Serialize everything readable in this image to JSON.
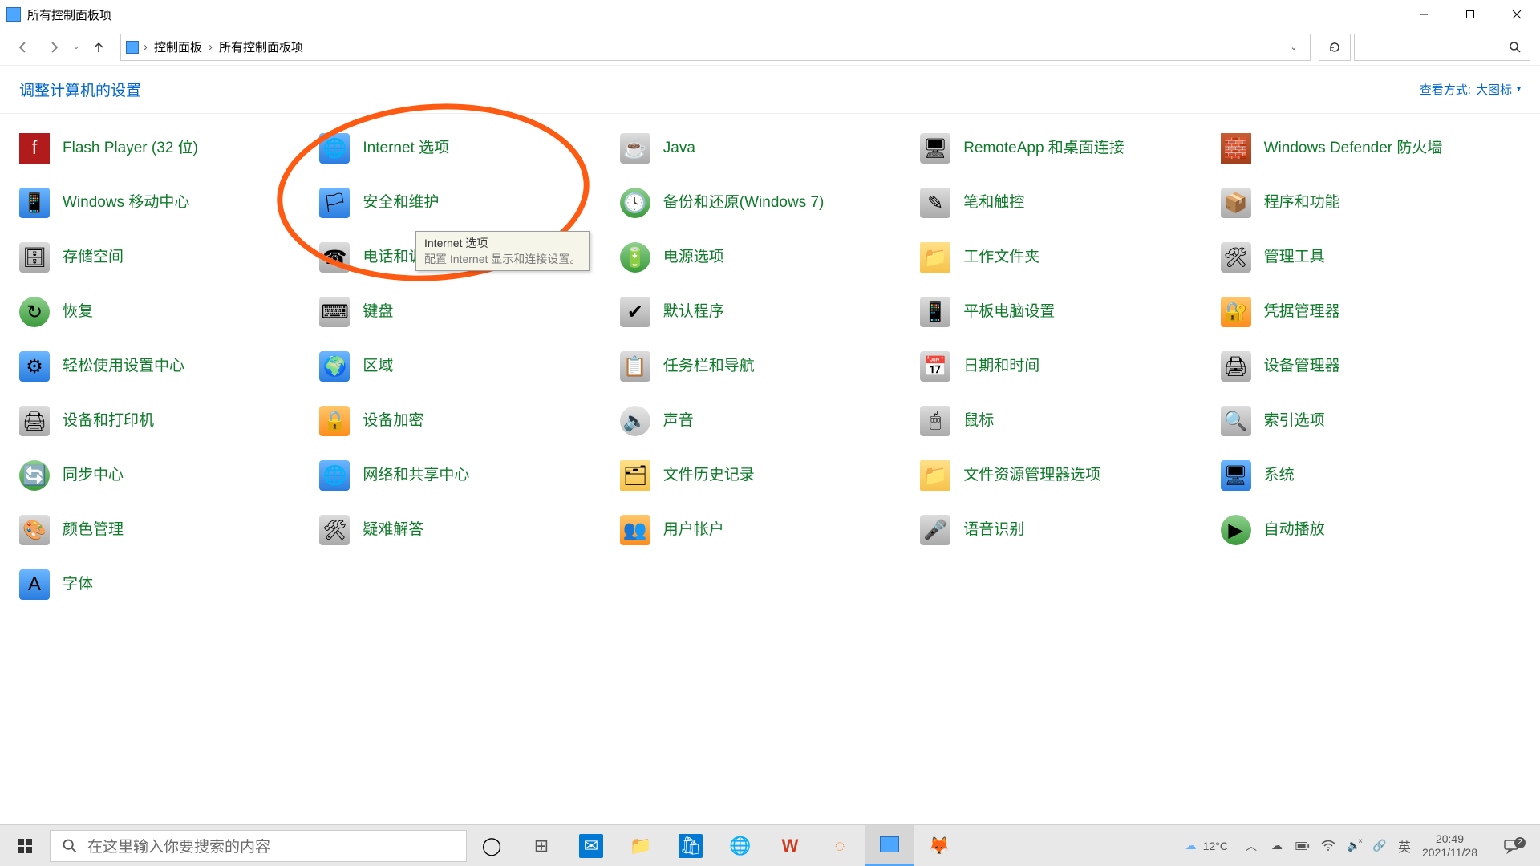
{
  "window": {
    "title": "所有控制面板项"
  },
  "nav": {
    "breadcrumb": [
      "控制面板",
      "所有控制面板项"
    ]
  },
  "header": {
    "title": "调整计算机的设置",
    "view_label": "查看方式:",
    "view_value": "大图标"
  },
  "tooltip": {
    "title": "Internet 选项",
    "desc": "配置 Internet 显示和连接设置。"
  },
  "items": [
    {
      "label": "Flash Player (32 位)",
      "name": "flash-player",
      "ic": "ic1",
      "ch": "f"
    },
    {
      "label": "Internet 选项",
      "name": "internet-options",
      "ic": "ic-blue",
      "ch": "🌐"
    },
    {
      "label": "Java",
      "name": "java",
      "ic": "ic-grey",
      "ch": "☕"
    },
    {
      "label": "RemoteApp 和桌面连接",
      "name": "remoteapp",
      "ic": "ic-grey",
      "ch": "🖥"
    },
    {
      "label": "Windows Defender 防火墙",
      "name": "windows-defender-firewall",
      "ic": "ic-firewall",
      "ch": "🧱",
      "twoline": true
    },
    {
      "label": "Windows 移动中心",
      "name": "mobility-center",
      "ic": "ic-blue",
      "ch": "📱"
    },
    {
      "label": "安全和维护",
      "name": "security-maintenance",
      "ic": "ic-blue",
      "ch": "🏳"
    },
    {
      "label": "备份和还原(Windows 7)",
      "name": "backup-restore",
      "ic": "ic-green",
      "ch": "🕓"
    },
    {
      "label": "笔和触控",
      "name": "pen-touch",
      "ic": "ic-grey",
      "ch": "✎"
    },
    {
      "label": "程序和功能",
      "name": "programs-features",
      "ic": "ic-grey",
      "ch": "📦"
    },
    {
      "label": "存储空间",
      "name": "storage-spaces",
      "ic": "ic-grey",
      "ch": "🗄"
    },
    {
      "label": "电话和调制解调器",
      "name": "phone-modem",
      "ic": "ic-grey",
      "ch": "☎"
    },
    {
      "label": "电源选项",
      "name": "power-options",
      "ic": "ic-green",
      "ch": "🔋"
    },
    {
      "label": "工作文件夹",
      "name": "work-folders",
      "ic": "ic-folder",
      "ch": "📁"
    },
    {
      "label": "管理工具",
      "name": "admin-tools",
      "ic": "ic-grey",
      "ch": "🛠"
    },
    {
      "label": "恢复",
      "name": "recovery",
      "ic": "ic-green",
      "ch": "↻"
    },
    {
      "label": "键盘",
      "name": "keyboard",
      "ic": "ic-grey",
      "ch": "⌨"
    },
    {
      "label": "默认程序",
      "name": "default-programs",
      "ic": "ic-grey",
      "ch": "✔"
    },
    {
      "label": "平板电脑设置",
      "name": "tablet-pc",
      "ic": "ic-grey",
      "ch": "📱"
    },
    {
      "label": "凭据管理器",
      "name": "credential-manager",
      "ic": "ic-orange",
      "ch": "🔐"
    },
    {
      "label": "轻松使用设置中心",
      "name": "ease-of-access",
      "ic": "ic-blue",
      "ch": "⚙"
    },
    {
      "label": "区域",
      "name": "region",
      "ic": "ic-blue",
      "ch": "🌍"
    },
    {
      "label": "任务栏和导航",
      "name": "taskbar-navigation",
      "ic": "ic-grey",
      "ch": "📋"
    },
    {
      "label": "日期和时间",
      "name": "date-time",
      "ic": "ic-grey",
      "ch": "📅"
    },
    {
      "label": "设备管理器",
      "name": "device-manager",
      "ic": "ic-grey",
      "ch": "🖨"
    },
    {
      "label": "设备和打印机",
      "name": "devices-printers",
      "ic": "ic-grey",
      "ch": "🖨"
    },
    {
      "label": "设备加密",
      "name": "device-encryption",
      "ic": "ic-orange",
      "ch": "🔒"
    },
    {
      "label": "声音",
      "name": "sound",
      "ic": "ic-disk",
      "ch": "🔈"
    },
    {
      "label": "鼠标",
      "name": "mouse",
      "ic": "ic-grey",
      "ch": "🖱"
    },
    {
      "label": "索引选项",
      "name": "indexing-options",
      "ic": "ic-grey",
      "ch": "🔍"
    },
    {
      "label": "同步中心",
      "name": "sync-center",
      "ic": "ic-green",
      "ch": "🔄"
    },
    {
      "label": "网络和共享中心",
      "name": "network-sharing",
      "ic": "ic-blue",
      "ch": "🌐"
    },
    {
      "label": "文件历史记录",
      "name": "file-history",
      "ic": "ic-folder",
      "ch": "🗂"
    },
    {
      "label": "文件资源管理器选项",
      "name": "explorer-options",
      "ic": "ic-folder",
      "ch": "📁"
    },
    {
      "label": "系统",
      "name": "system",
      "ic": "ic-blue",
      "ch": "🖥"
    },
    {
      "label": "颜色管理",
      "name": "color-management",
      "ic": "ic-grey",
      "ch": "🎨"
    },
    {
      "label": "疑难解答",
      "name": "troubleshooting",
      "ic": "ic-grey",
      "ch": "🛠"
    },
    {
      "label": "用户帐户",
      "name": "user-accounts",
      "ic": "ic-orange",
      "ch": "👥"
    },
    {
      "label": "语音识别",
      "name": "speech-recognition",
      "ic": "ic-grey",
      "ch": "🎤"
    },
    {
      "label": "自动播放",
      "name": "autoplay",
      "ic": "ic-green",
      "ch": "▶"
    },
    {
      "label": "字体",
      "name": "fonts",
      "ic": "ic-blue",
      "ch": "A"
    }
  ],
  "taskbar": {
    "search_placeholder": "在这里输入你要搜索的内容",
    "weather_temp": "12°C",
    "ime": "英",
    "time": "20:49",
    "date": "2021/11/28",
    "notif_count": "2"
  }
}
